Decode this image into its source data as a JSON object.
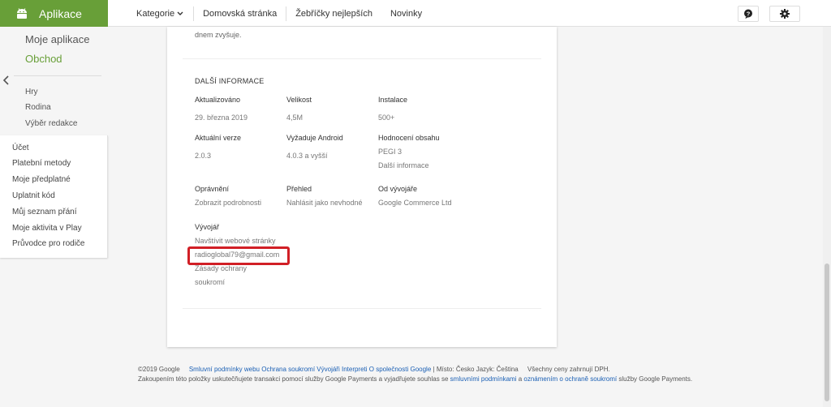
{
  "header": {
    "brand": "Aplikace",
    "nav": {
      "categories": "Kategorie",
      "home": "Domovská stránka",
      "charts": "Žebříčky nejlepších",
      "new": "Novinky"
    }
  },
  "sidebar": {
    "my_apps": "Moje aplikace",
    "store": "Obchod",
    "sub": [
      "Hry",
      "Rodina",
      "Výběr redakce"
    ],
    "account": [
      "Účet",
      "Platební metody",
      "Moje předplatné",
      "Uplatnit kód",
      "Můj seznam přání",
      "Moje aktivita v Play",
      "Průvodce pro rodiče"
    ]
  },
  "main": {
    "tail_text": "dnem zvyšuje.",
    "section_title": "DALŠÍ INFORMACE",
    "fields": {
      "updated": {
        "label": "Aktualizováno",
        "value": "29. března 2019"
      },
      "size": {
        "label": "Velikost",
        "value": "4,5M"
      },
      "installs": {
        "label": "Instalace",
        "value": "500+"
      },
      "version": {
        "label": "Aktuální verze",
        "value": "2.0.3"
      },
      "requires": {
        "label": "Vyžaduje Android",
        "value": "4.0.3 a vyšší"
      },
      "rating": {
        "label": "Hodnocení obsahu",
        "value": "PEGI 3",
        "link": "Další informace"
      },
      "permissions": {
        "label": "Oprávnění",
        "link": "Zobrazit podrobnosti"
      },
      "report": {
        "label": "Přehled",
        "link": "Nahlásit jako nevhodné"
      },
      "offered_by": {
        "label": "Od vývojáře",
        "value": "Google Commerce Ltd"
      }
    },
    "developer": {
      "label": "Vývojář",
      "website": "Navštívit webové stránky",
      "email": "radioglobal79@gmail.com",
      "privacy_1": "Zásady ochrany",
      "privacy_2": "soukromí"
    }
  },
  "footer": {
    "copyright": "©2019 Google",
    "links": [
      "Smluvní podmínky webu",
      "Ochrana soukromí",
      "Vývojáři",
      "Interpreti",
      "O společnosti Google"
    ],
    "location": "| Místo: Česko  Jazyk: Čeština",
    "prices": "Všechny ceny zahrnují DPH.",
    "line2_a": "Zakoupením této položky uskutečňujete transakci pomocí služby Google Payments a vyjadřujete souhlas se",
    "line2_link1": "smluvními podmínkami",
    "line2_b": "a",
    "line2_link2": "oznámením o ochraně soukromí",
    "line2_c": "služby Google Payments."
  },
  "colors": {
    "brand": "#689f38",
    "highlight": "#d11f26",
    "link": "#1a5fb4"
  }
}
